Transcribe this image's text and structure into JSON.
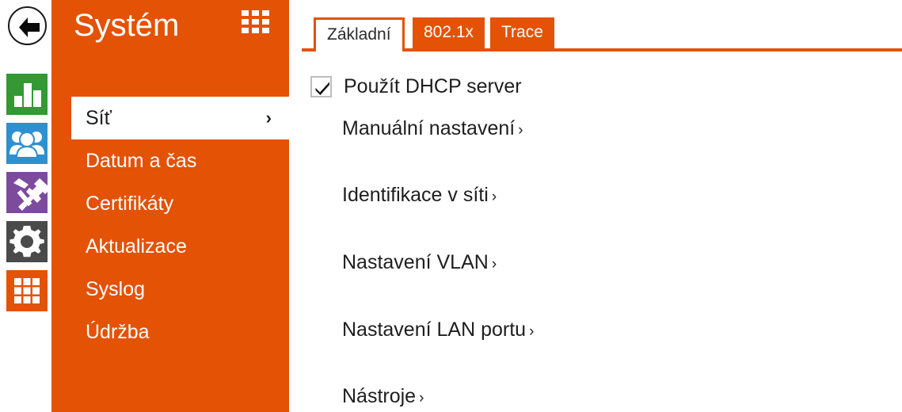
{
  "colors": {
    "accent_orange": "#e35205",
    "icon_green": "#339933",
    "icon_blue": "#2e90d0",
    "icon_purple": "#7d4b9e",
    "icon_gray": "#4a4a4a",
    "icon_orange": "#e35205",
    "text_dark": "#1e1e1e",
    "white": "#ffffff"
  },
  "rail": {
    "back_button": {
      "name": "back-arrow-icon",
      "label": "Back"
    },
    "items": [
      {
        "icon": "bar-chart-icon",
        "name": "status",
        "color": "#339933"
      },
      {
        "icon": "users-icon",
        "name": "directory",
        "color": "#2e90d0"
      },
      {
        "icon": "tools-icon",
        "name": "hardware",
        "color": "#7d4b9e"
      },
      {
        "icon": "gear-icon",
        "name": "services",
        "color": "#4a4a4a"
      },
      {
        "icon": "grid-icon",
        "name": "system",
        "color": "#e35205"
      }
    ]
  },
  "panel": {
    "title": "Systém",
    "grid_toggle_icon": "grid-menu-icon",
    "items": [
      {
        "label": "Síť",
        "active": true,
        "chevron": "›"
      },
      {
        "label": "Datum a čas",
        "active": false,
        "chevron": ""
      },
      {
        "label": "Certifikáty",
        "active": false,
        "chevron": ""
      },
      {
        "label": "Aktualizace",
        "active": false,
        "chevron": ""
      },
      {
        "label": "Syslog",
        "active": false,
        "chevron": ""
      },
      {
        "label": "Údržba",
        "active": false,
        "chevron": ""
      }
    ]
  },
  "content": {
    "tabs": [
      {
        "label": "Základní",
        "active": true
      },
      {
        "label": "802.1x",
        "active": false
      },
      {
        "label": "Trace",
        "active": false
      }
    ],
    "checkbox": {
      "label": "Použít DHCP server",
      "checked": true,
      "icon": "checkmark-icon"
    },
    "links": [
      {
        "label": "Manuální nastavení",
        "chevron": "›"
      },
      {
        "label": "Identifikace v síti",
        "chevron": "›"
      },
      {
        "label": "Nastavení VLAN",
        "chevron": "›"
      },
      {
        "label": "Nastavení LAN portu",
        "chevron": "›"
      },
      {
        "label": "Nástroje",
        "chevron": "›"
      }
    ]
  }
}
